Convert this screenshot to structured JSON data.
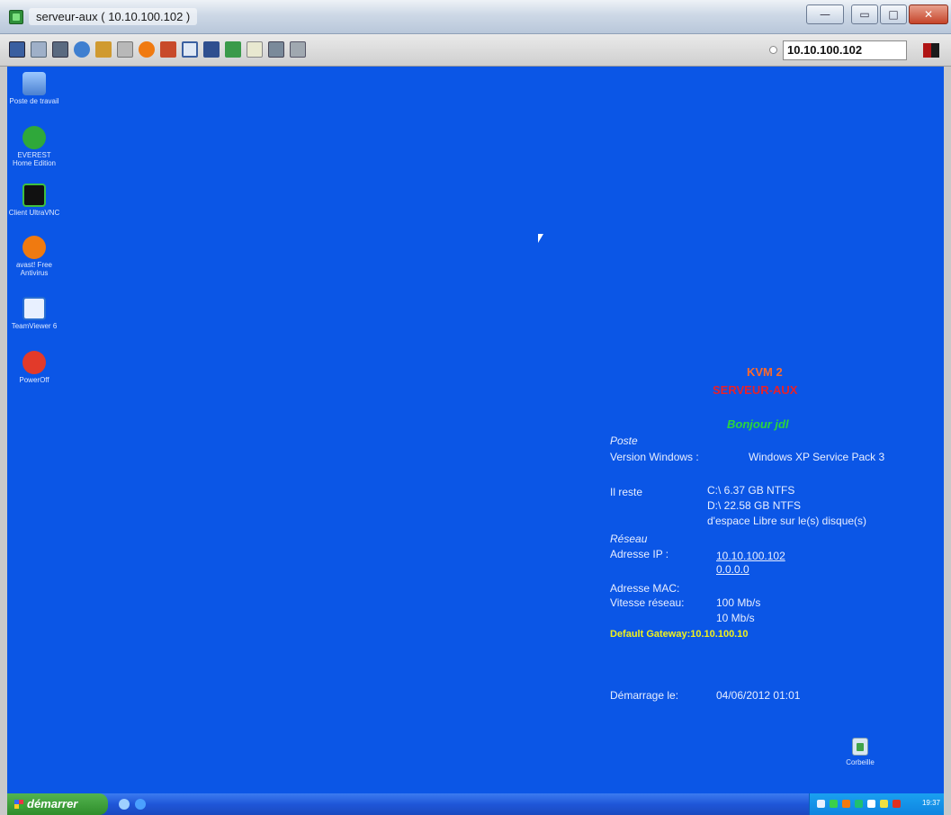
{
  "window": {
    "title": "serveur-aux ( 10.10.100.102 )",
    "minimize_glyph": "—",
    "restore_glyph": "▭",
    "maximize_glyph": "□",
    "close_glyph": "✕"
  },
  "toolbar": {
    "icons": [
      "monitor-icon",
      "network-icon",
      "tools-icon",
      "refresh-icon",
      "paint-icon",
      "folder-icon",
      "record-icon",
      "cut-icon",
      "fullscreen-icon",
      "screen-icon",
      "send-icon",
      "document-icon",
      "image-icon",
      "settings-icon"
    ],
    "target_ip": "10.10.100.102"
  },
  "desktop": {
    "icons": [
      {
        "label": "Poste de travail",
        "icon": "my-computer-icon"
      },
      {
        "label": "EVEREST Home Edition",
        "icon": "everest-icon"
      },
      {
        "label": "Client UltraVNC",
        "icon": "ultravnc-icon"
      },
      {
        "label": "avast! Free Antivirus",
        "icon": "avast-icon"
      },
      {
        "label": "TeamViewer 6",
        "icon": "teamviewer-icon"
      },
      {
        "label": "PowerOff",
        "icon": "poweroff-icon"
      }
    ],
    "trash_label": "Corbeille"
  },
  "bginfo": {
    "kvm": "KVM 2",
    "server": "SERVEUR-AUX",
    "greeting": "Bonjour  jdl",
    "poste_heading": "Poste",
    "version_label": "Version Windows :",
    "version_value": "Windows XP Service Pack 3",
    "reste_label": "Il reste",
    "disk_c": "C:\\ 6.37 GB NTFS",
    "disk_d": "D:\\ 22.58 GB NTFS",
    "disk_note": "d'espace Libre sur le(s) disque(s)",
    "reseau_heading": "Réseau",
    "ip_label": "Adresse IP :",
    "ip_value": "10.10.100.102",
    "ip_value2": "0.0.0.0",
    "mac_label": "Adresse MAC:",
    "speed_label": "Vitesse réseau:",
    "speed_value": "100 Mb/s",
    "speed_value2": "10 Mb/s",
    "gateway": "Default Gateway:10.10.100.10",
    "boot_label": "Démarrage le:",
    "boot_value": "04/06/2012 01:01"
  },
  "colors": {
    "desktop_bg": "#0b56e6",
    "kvm_orange": "#ff6a2a",
    "server_red": "#e8202a",
    "greeting_green": "#2bd63b",
    "gateway_yellow": "#f2f21a"
  },
  "taskbar": {
    "start_label": "démarrer",
    "clock": "19:37"
  }
}
